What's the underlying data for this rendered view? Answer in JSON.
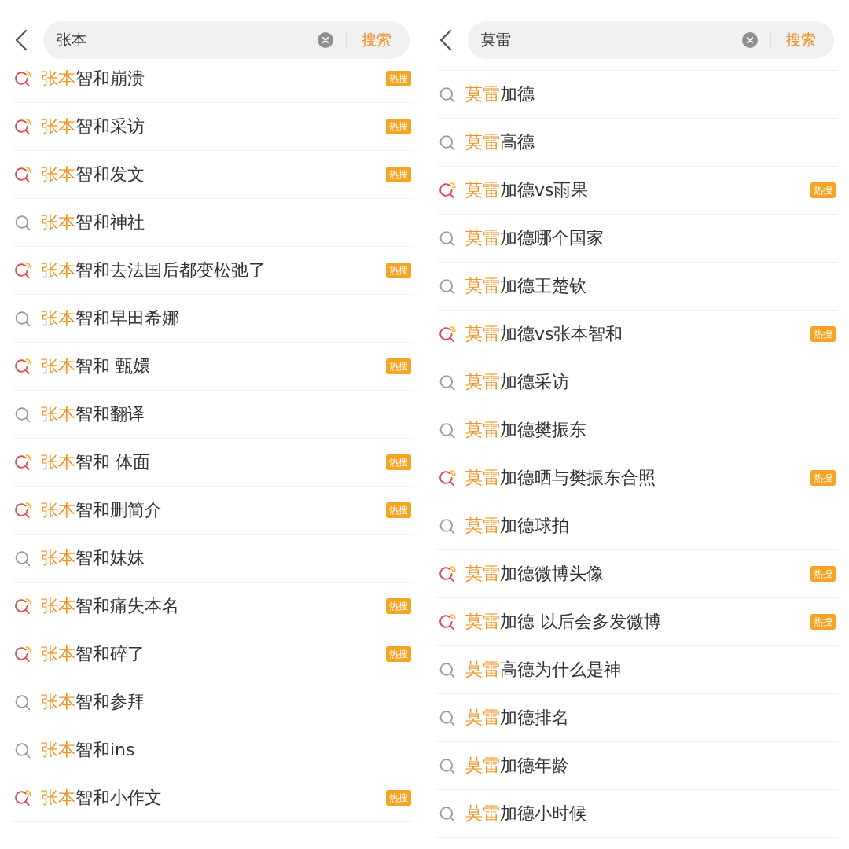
{
  "panels": [
    {
      "search": {
        "value": "张本",
        "button": "搜索"
      },
      "suggestions": [
        {
          "match": "张本",
          "rest": "智和崩溃",
          "hot": true,
          "badge": "热搜"
        },
        {
          "match": "张本",
          "rest": "智和采访",
          "hot": true,
          "badge": "热搜"
        },
        {
          "match": "张本",
          "rest": "智和发文",
          "hot": true,
          "badge": "热搜"
        },
        {
          "match": "张本",
          "rest": "智和神社",
          "hot": false
        },
        {
          "match": "张本",
          "rest": "智和去法国后都变松弛了",
          "hot": true,
          "badge": "热搜"
        },
        {
          "match": "张本",
          "rest": "智和早田希娜",
          "hot": false
        },
        {
          "match": "张本",
          "rest": "智和 甄嬛",
          "hot": true,
          "badge": "热搜"
        },
        {
          "match": "张本",
          "rest": "智和翻译",
          "hot": false
        },
        {
          "match": "张本",
          "rest": "智和 体面",
          "hot": true,
          "badge": "热搜"
        },
        {
          "match": "张本",
          "rest": "智和删简介",
          "hot": true,
          "badge": "热搜"
        },
        {
          "match": "张本",
          "rest": "智和妹妹",
          "hot": false
        },
        {
          "match": "张本",
          "rest": "智和痛失本名",
          "hot": true,
          "badge": "热搜"
        },
        {
          "match": "张本",
          "rest": "智和碎了",
          "hot": true,
          "badge": "热搜"
        },
        {
          "match": "张本",
          "rest": "智和参拜",
          "hot": false
        },
        {
          "match": "张本",
          "rest": "智和ins",
          "hot": false
        },
        {
          "match": "张本",
          "rest": "智和小作文",
          "hot": true,
          "badge": "热搜"
        }
      ]
    },
    {
      "search": {
        "value": "莫雷",
        "button": "搜索"
      },
      "suggestions": [
        {
          "match": "莫雷",
          "rest": "加德",
          "hot": false
        },
        {
          "match": "莫雷",
          "rest": "高德",
          "hot": false
        },
        {
          "match": "莫雷",
          "rest": "加德vs雨果",
          "hot": true,
          "badge": "热搜"
        },
        {
          "match": "莫雷",
          "rest": "加德哪个国家",
          "hot": false
        },
        {
          "match": "莫雷",
          "rest": "加德王楚钦",
          "hot": false
        },
        {
          "match": "莫雷",
          "rest": "加德vs张本智和",
          "hot": true,
          "badge": "热搜"
        },
        {
          "match": "莫雷",
          "rest": "加德采访",
          "hot": false
        },
        {
          "match": "莫雷",
          "rest": "加德樊振东",
          "hot": false
        },
        {
          "match": "莫雷",
          "rest": "加德晒与樊振东合照",
          "hot": true,
          "badge": "热搜"
        },
        {
          "match": "莫雷",
          "rest": "加德球拍",
          "hot": false
        },
        {
          "match": "莫雷",
          "rest": "加德微博头像",
          "hot": true,
          "badge": "热搜"
        },
        {
          "match": "莫雷",
          "rest": "加德 以后会多发微博",
          "hot": true,
          "badge": "热搜"
        },
        {
          "match": "莫雷",
          "rest": "高德为什么是神",
          "hot": false
        },
        {
          "match": "莫雷",
          "rest": "加德排名",
          "hot": false
        },
        {
          "match": "莫雷",
          "rest": "加德年龄",
          "hot": false
        },
        {
          "match": "莫雷",
          "rest": "加德小时候",
          "hot": false
        }
      ]
    }
  ]
}
